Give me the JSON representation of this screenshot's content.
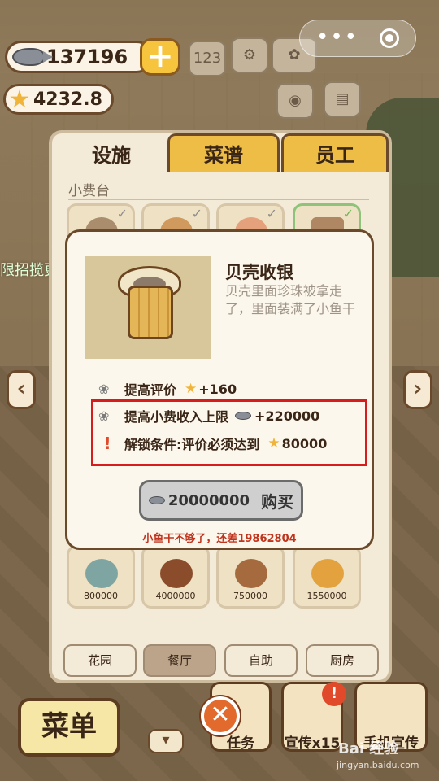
{
  "hud": {
    "fish_count": "137196",
    "star_count": "4232.8",
    "hint_text": "限招揽更多的顾客"
  },
  "tabs": [
    {
      "label": "设施",
      "active": true
    },
    {
      "label": "菜谱",
      "active": false
    },
    {
      "label": "员工",
      "active": false
    }
  ],
  "section_label": "小费台",
  "bottom_items": [
    {
      "price": "800000"
    },
    {
      "price": "4000000"
    },
    {
      "price": "750000"
    },
    {
      "price": "1550000"
    }
  ],
  "categories": [
    {
      "label": "花园",
      "selected": false
    },
    {
      "label": "餐厅",
      "selected": true
    },
    {
      "label": "自助",
      "selected": false
    },
    {
      "label": "厨房",
      "selected": false
    }
  ],
  "popup": {
    "title": "贝壳收银",
    "description": "贝壳里面珍珠被拿走了，里面装满了小鱼干",
    "rating_label": "提高评价",
    "rating_value": "+160",
    "tip_label": "提高小费收入上限",
    "tip_value": "+220000",
    "unlock_label": "解锁条件:评价必须达到",
    "unlock_value": "80000",
    "price": "20000000",
    "buy_label": "购买",
    "warning": "小鱼干不够了，还差19862804"
  },
  "bottom_bar": {
    "menu_label": "菜单",
    "task_label": "任务",
    "promo_label": "宣传x15",
    "phone_promo_label": "手机宣传"
  },
  "watermark": {
    "brand": "Bai 经验",
    "url": "jingyan.baidu.com"
  },
  "colors": {
    "tab_inactive": "#eebd45",
    "highlight_box": "#d81c1c",
    "warning_text": "#c0341d"
  }
}
